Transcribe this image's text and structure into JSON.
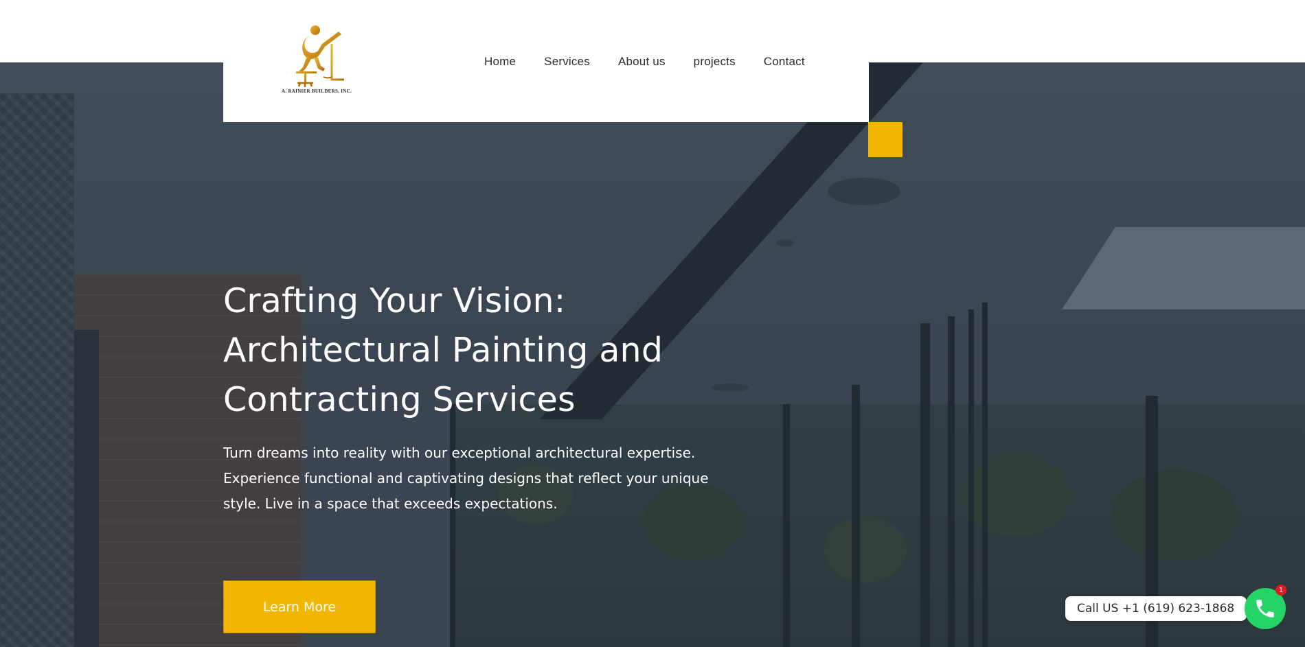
{
  "brand": {
    "logo_icon": "painter-figure-logo-icon",
    "logo_text": "A. RAINIER BUILDERS, INC.",
    "gold": "#c9900e",
    "accent": "#f2b600"
  },
  "nav": {
    "items": [
      {
        "label": "Home"
      },
      {
        "label": "Services"
      },
      {
        "label": "About us"
      },
      {
        "label": "projects"
      },
      {
        "label": "Contact"
      }
    ]
  },
  "hero": {
    "headline": "Crafting Your Vision: Architectural Painting and Contracting Services",
    "subtext": "Turn dreams into reality with our exceptional architectural expertise. Experience functional and captivating designs that reflect your unique style. Live in a space that exceeds expectations.",
    "cta_label": "Learn More"
  },
  "call_widget": {
    "label": "Call US +1 (619) 623-1868",
    "icon": "phone-icon",
    "badge_count": "1",
    "color": "#25d366"
  }
}
